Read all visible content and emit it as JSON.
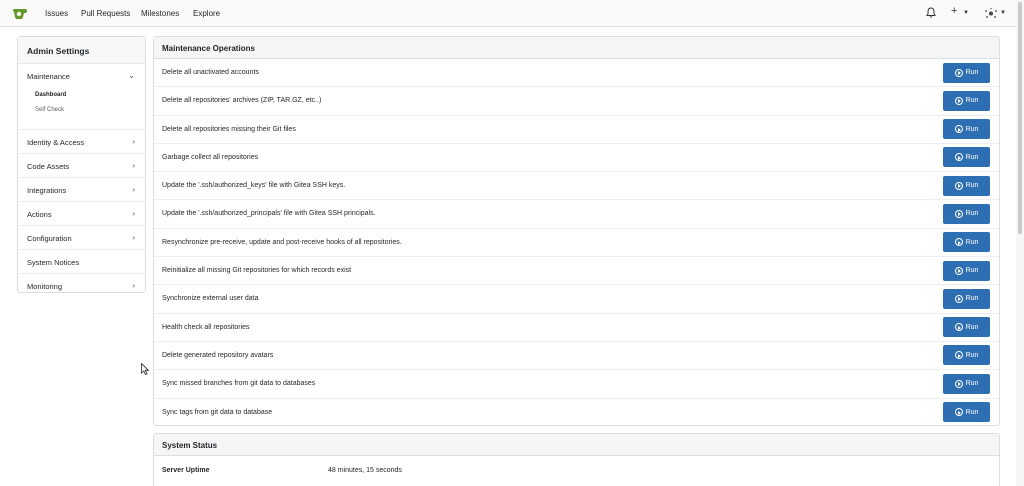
{
  "nav": {
    "links": [
      "Issues",
      "Pull Requests",
      "Milestones",
      "Explore"
    ],
    "notification_icon": "bell-icon",
    "create_icon": "plus-icon",
    "avatar_icon": "user-avatar-icon"
  },
  "sidebar": {
    "title": "Admin Settings",
    "maintenance": {
      "label": "Maintenance",
      "sub": [
        "Dashboard",
        "Self Check"
      ]
    },
    "items": [
      {
        "label": "Identity & Access",
        "has_chevron": true
      },
      {
        "label": "Code Assets",
        "has_chevron": true
      },
      {
        "label": "Integrations",
        "has_chevron": true
      },
      {
        "label": "Actions",
        "has_chevron": true
      },
      {
        "label": "Configuration",
        "has_chevron": true
      },
      {
        "label": "System Notices",
        "has_chevron": false
      },
      {
        "label": "Monitoring",
        "has_chevron": true
      }
    ]
  },
  "maintenance": {
    "title": "Maintenance Operations",
    "run_label": "Run",
    "operations": [
      "Delete all unactivated accounts",
      "Delete all repositories' archives (ZIP, TAR.GZ, etc..)",
      "Delete all repositories missing their Git files",
      "Garbage collect all repositories",
      "Update the '.ssh/authorized_keys' file with Gitea SSH keys.",
      "Update the '.ssh/authorized_principals' file with Gitea SSH principals.",
      "Resynchronize pre-receive, update and post-receive hooks of all repositories.",
      "Reinitialize all missing Git repositories for which records exist",
      "Synchronize external user data",
      "Health check all repositories",
      "Delete generated repository avatars",
      "Sync missed branches from git data to databases",
      "Sync tags from git data to database"
    ]
  },
  "system_status": {
    "title": "System Status",
    "rows": [
      {
        "key": "Server Uptime",
        "value": "48 minutes, 15 seconds"
      }
    ]
  },
  "colors": {
    "run_button": "#2e6fb3",
    "logo": "#609926"
  }
}
